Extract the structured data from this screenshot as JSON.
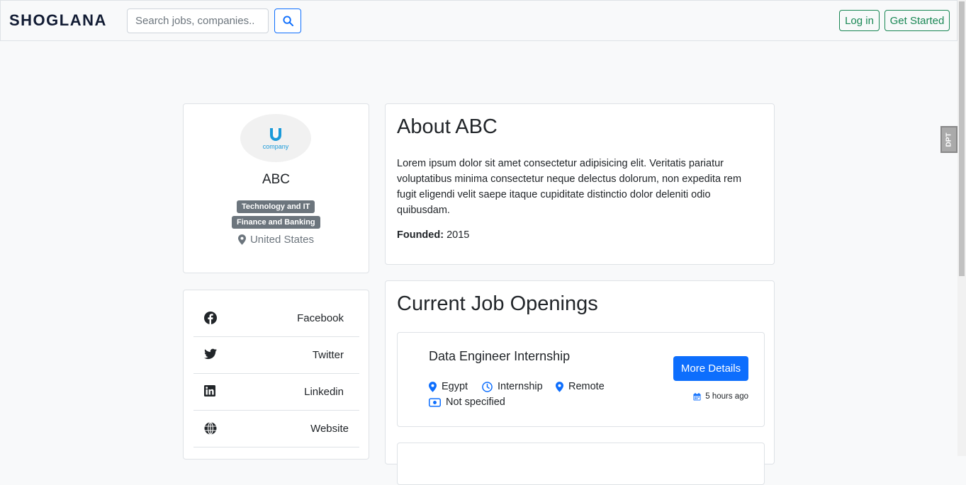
{
  "nav": {
    "brand": "SHOGLANA",
    "search_placeholder": "Search jobs, companies..",
    "login_label": "Log in",
    "get_started_label": "Get Started"
  },
  "side_tab": {
    "label": "DPT"
  },
  "company": {
    "logo_text": "company",
    "name": "ABC",
    "industries": [
      "Technology and IT",
      "Finance and Banking"
    ],
    "location": "United States"
  },
  "social": {
    "items": [
      {
        "label": "Facebook",
        "icon": "facebook-icon"
      },
      {
        "label": "Twitter",
        "icon": "twitter-icon"
      },
      {
        "label": "Linkedin",
        "icon": "linkedin-icon"
      },
      {
        "label": "Website",
        "icon": "globe-icon"
      }
    ]
  },
  "about": {
    "title": "About ABC",
    "description": "Lorem ipsum dolor sit amet consectetur adipisicing elit. Veritatis pariatur voluptatibus minima consectetur neque delectus dolorum, non expedita rem fugit eligendi velit saepe itaque cupiditate distinctio dolor deleniti odio quibusdam.",
    "founded_label": "Founded:",
    "founded_value": "2015"
  },
  "jobs": {
    "title": "Current Job Openings",
    "items": [
      {
        "title": "Data Engineer Internship",
        "country": "Egypt",
        "type": "Internship",
        "workplace": "Remote",
        "salary": "Not specified",
        "details_label": "More Details",
        "posted": "5 hours ago"
      }
    ]
  },
  "colors": {
    "primary": "#0d6efd",
    "success": "#198754",
    "badge": "#6c757d",
    "brand_text": "#111b33",
    "logo_blue": "#1a9ad9"
  }
}
